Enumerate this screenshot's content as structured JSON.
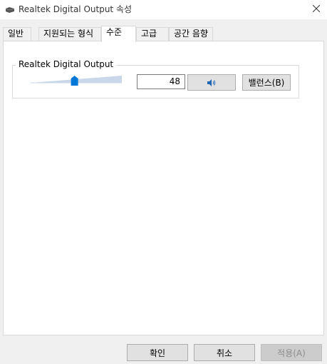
{
  "window": {
    "title": "Realtek Digital Output 속성",
    "icon": "speaker-device-icon",
    "close_icon": "close-icon"
  },
  "tabs": [
    {
      "label": "일반",
      "active": false
    },
    {
      "label": "지원되는 형식",
      "active": false
    },
    {
      "label": "수준",
      "active": true
    },
    {
      "label": "고급",
      "active": false
    },
    {
      "label": "공간 음향",
      "active": false
    }
  ],
  "level_group": {
    "title": "Realtek Digital Output",
    "slider_value": 48,
    "slider_max": 100,
    "level_value": "48",
    "mute_icon": "speaker-volume-icon",
    "balance_label": "밸런스(B)"
  },
  "footer": {
    "ok_label": "확인",
    "cancel_label": "취소",
    "apply_label": "적용(A)",
    "apply_enabled": false
  },
  "colors": {
    "accent": "#0078d7",
    "slider_track": "#c7d5e6"
  }
}
